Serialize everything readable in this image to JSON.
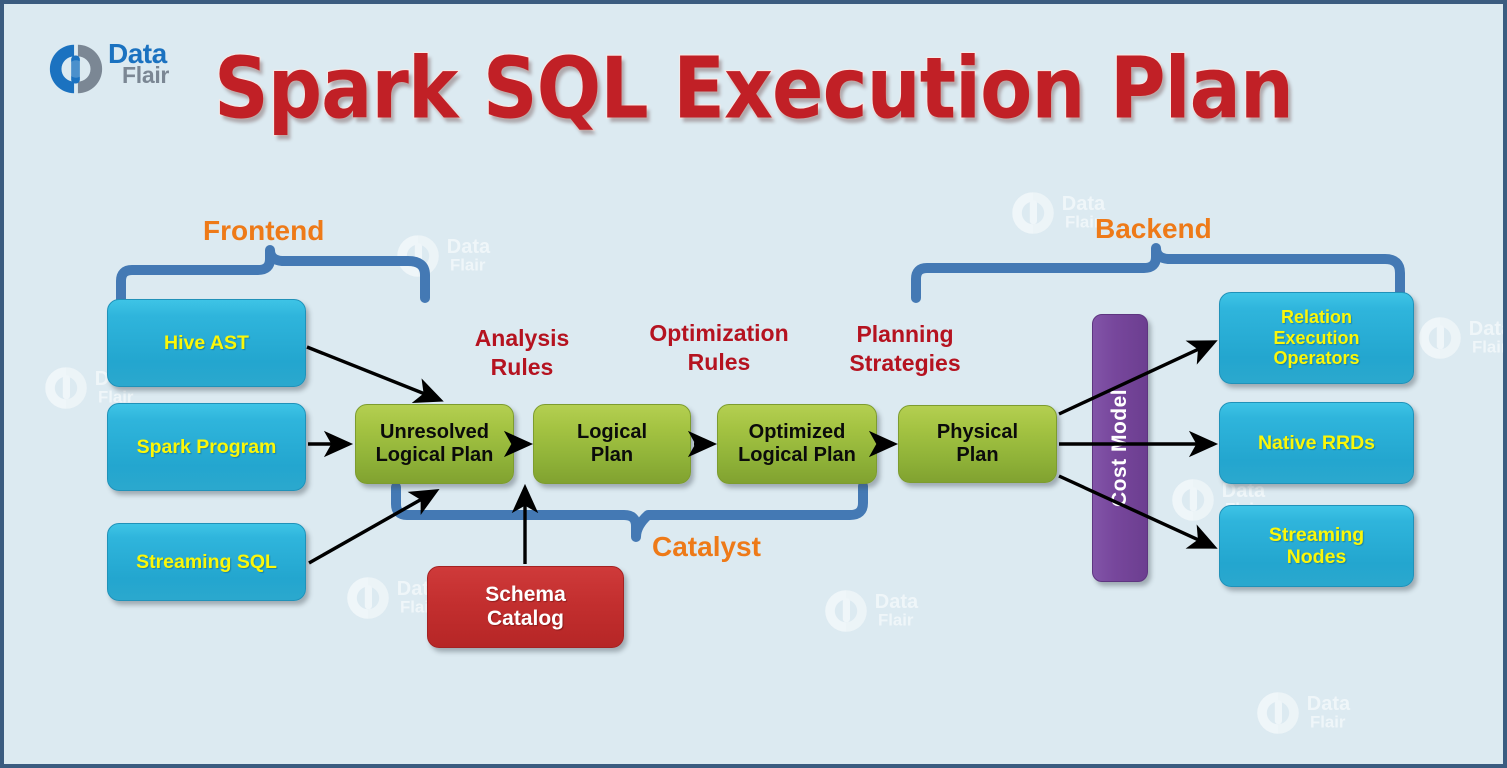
{
  "page": {
    "title": "Spark SQL Execution Plan",
    "background_color": "#dceaf1",
    "border_color": "#3b5c80",
    "title_color": "#c12026"
  },
  "brand": {
    "logo_name": "dataflair-logo",
    "line1": "Data",
    "line2": "Flair",
    "color_primary": "#1b72c0",
    "color_secondary": "#7b8794"
  },
  "groups": [
    {
      "id": "frontend",
      "label": "Frontend",
      "color": "#ee7a18"
    },
    {
      "id": "catalyst",
      "label": "Catalyst",
      "color": "#ee7a18"
    },
    {
      "id": "backend",
      "label": "Backend",
      "color": "#ee7a18"
    }
  ],
  "stage_labels": [
    {
      "id": "analysis-rules",
      "line1": "Analysis",
      "line2": "Rules",
      "color": "#b51320"
    },
    {
      "id": "optimization-rules",
      "line1": "Optimization",
      "line2": "Rules",
      "color": "#b51320"
    },
    {
      "id": "planning-strategies",
      "line1": "Planning",
      "line2": "Strategies",
      "color": "#b51320"
    }
  ],
  "inputs": [
    {
      "id": "hive-ast",
      "label": "Hive AST",
      "color": "#23a6cf",
      "text_color": "#fbf708"
    },
    {
      "id": "spark-program",
      "label": "Spark Program",
      "color": "#23a6cf",
      "text_color": "#fbf708"
    },
    {
      "id": "streaming-sql",
      "label": "Streaming SQL",
      "color": "#23a6cf",
      "text_color": "#fbf708"
    }
  ],
  "plans": [
    {
      "id": "unresolved-logical-plan",
      "line1": "Unresolved",
      "line2": "Logical Plan",
      "color": "#8fb238"
    },
    {
      "id": "logical-plan",
      "line1": "Logical",
      "line2": "Plan",
      "color": "#8fb238"
    },
    {
      "id": "optimized-logical-plan",
      "line1": "Optimized",
      "line2": "Logical Plan",
      "color": "#8fb238"
    },
    {
      "id": "physical-plan",
      "line1": "Physical",
      "line2": "Plan",
      "color": "#8fb238"
    }
  ],
  "catalog": {
    "id": "schema-catalog",
    "line1": "Schema",
    "line2": "Catalog",
    "color": "#c32f2f"
  },
  "cost_model": {
    "id": "cost-model",
    "label": "Cost Model",
    "color": "#77479c"
  },
  "outputs": [
    {
      "id": "relation-execution-operators",
      "line1": "Relation",
      "line2": "Execution",
      "line3": "Operators",
      "color": "#23a6cf"
    },
    {
      "id": "native-rrds",
      "line1": "Native RRDs",
      "line2": "",
      "line3": "",
      "color": "#23a6cf"
    },
    {
      "id": "streaming-nodes",
      "line1": "Streaming",
      "line2": "Nodes",
      "line3": "",
      "color": "#23a6cf"
    }
  ],
  "watermarks": {
    "label_line1": "Data",
    "label_line2": "Flair",
    "count": 7
  }
}
